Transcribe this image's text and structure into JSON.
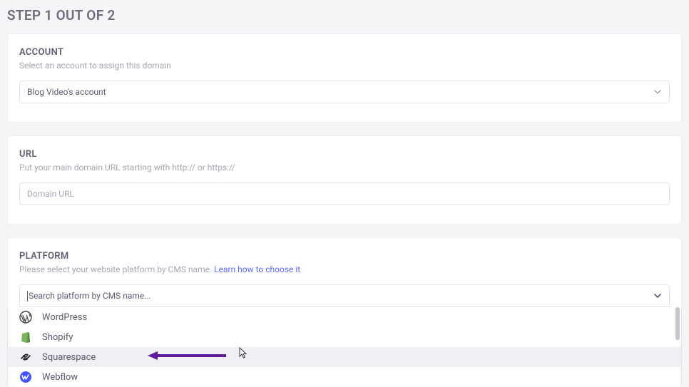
{
  "page_title": "STEP 1 OUT OF 2",
  "account": {
    "heading": "ACCOUNT",
    "sub": "Select an account to assign this domain",
    "selected": "Blog Video's account"
  },
  "url": {
    "heading": "URL",
    "sub": "Put your main domain URL starting with http:// or https://",
    "placeholder": "Domain URL",
    "value": ""
  },
  "platform": {
    "heading": "PLATFORM",
    "sub_prefix": "Please select your website platform by CMS name.  ",
    "learn_link": "Learn how to choose it",
    "placeholder": "Search platform by CMS name...",
    "value": "",
    "options": [
      {
        "label": "WordPress",
        "icon": "wordpress",
        "hover": false
      },
      {
        "label": "Shopify",
        "icon": "shopify",
        "hover": false
      },
      {
        "label": "Squarespace",
        "icon": "squarespace",
        "hover": true
      },
      {
        "label": "Webflow",
        "icon": "webflow",
        "hover": false
      }
    ]
  }
}
